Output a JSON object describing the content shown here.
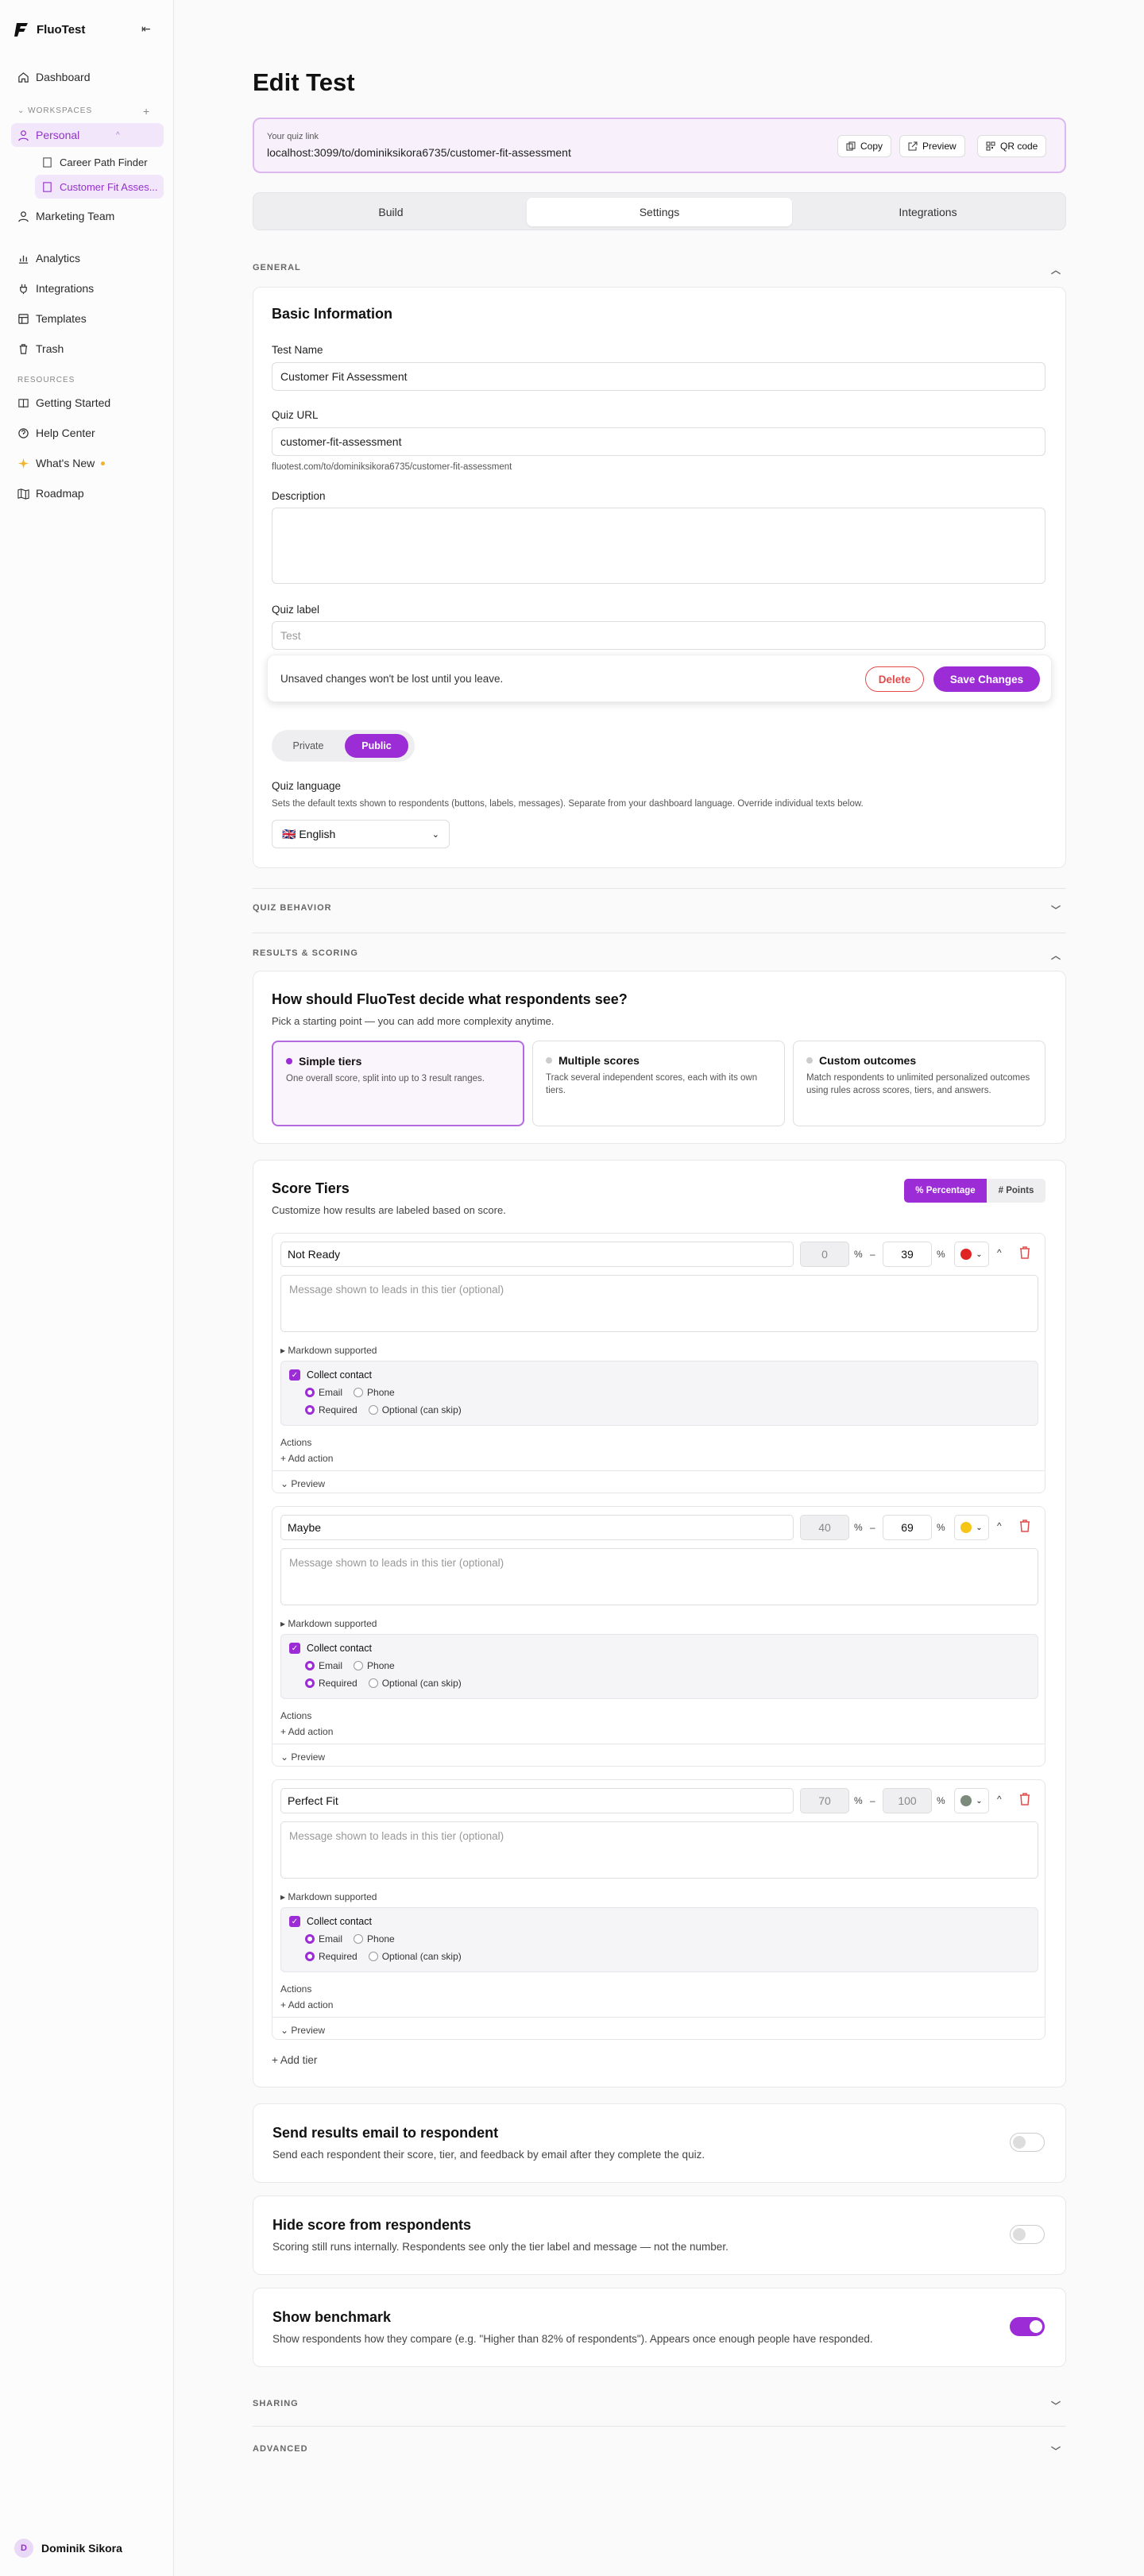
{
  "app": {
    "name": "FluoTest"
  },
  "sidebar": {
    "dashboard": "Dashboard",
    "workspaces_label": "WORKSPACES",
    "personal": "Personal",
    "sub_items": [
      "Career Path Finder",
      "Customer Fit Asses..."
    ],
    "marketing": "Marketing Team",
    "analytics": "Analytics",
    "integrations": "Integrations",
    "templates": "Templates",
    "trash": "Trash",
    "resources_label": "RESOURCES",
    "getting_started": "Getting Started",
    "help_center": "Help Center",
    "whats_new": "What's New",
    "roadmap": "Roadmap",
    "user_initial": "D",
    "user_name": "Dominik Sikora"
  },
  "page": {
    "title": "Edit Test"
  },
  "quiz_link": {
    "label": "Your quiz link",
    "url": "localhost:3099/to/dominiksikora6735/customer-fit-assessment",
    "copy": "Copy",
    "preview": "Preview",
    "qr": "QR code"
  },
  "tabs": [
    "Build",
    "Settings",
    "Integrations"
  ],
  "general": {
    "section": "GENERAL",
    "card_title": "Basic Information",
    "test_name_label": "Test Name",
    "test_name": "Customer Fit Assessment",
    "quiz_url_label": "Quiz URL",
    "quiz_url": "customer-fit-assessment",
    "quiz_url_hint": "fluotest.com/to/dominiksikora6735/customer-fit-assessment",
    "description_label": "Description",
    "quiz_label_label": "Quiz label",
    "quiz_label_placeholder": "Test",
    "visibility_private": "Private",
    "visibility_public": "Public",
    "language_label": "Quiz language",
    "language_hint": "Sets the default texts shown to respondents (buttons, labels, messages). Separate from your dashboard language. Override individual texts below.",
    "language_value": "🇬🇧 English"
  },
  "toast": {
    "message": "Unsaved changes won't be lost until you leave.",
    "delete": "Delete",
    "save": "Save Changes"
  },
  "quiz_behavior": {
    "section": "QUIZ BEHAVIOR"
  },
  "results": {
    "section": "RESULTS & SCORING",
    "question": "How should FluoTest decide what respondents see?",
    "hint": "Pick a starting point — you can add more complexity anytime.",
    "choices": [
      {
        "title": "Simple tiers",
        "desc": "One overall score, split into up to 3 result ranges."
      },
      {
        "title": "Multiple scores",
        "desc": "Track several independent scores, each with its own tiers."
      },
      {
        "title": "Custom outcomes",
        "desc": "Match respondents to unlimited personalized outcomes using rules across scores, tiers, and answers."
      }
    ]
  },
  "score_tiers": {
    "title": "Score Tiers",
    "subtitle": "Customize how results are labeled based on score.",
    "mode_percentage": "% Percentage",
    "mode_points": "# Points",
    "tiers": [
      {
        "name": "Not Ready",
        "min": "0",
        "max": "39",
        "color": "#e02424"
      },
      {
        "name": "Maybe",
        "min": "40",
        "max": "69",
        "color": "#f5c518"
      },
      {
        "name": "Perfect Fit",
        "min": "70",
        "max": "100",
        "color": "#7b8a7b"
      }
    ],
    "pct": "%",
    "dash": "–",
    "message_placeholder": "Message shown to leads in this tier (optional)",
    "markdown": "▸ Markdown supported",
    "collect_contact": "Collect contact",
    "email": "Email",
    "phone": "Phone",
    "required": "Required",
    "optional": "Optional (can skip)",
    "actions": "Actions",
    "add_action": "+ Add action",
    "preview": "⌄ Preview",
    "add_tier": "+ Add tier"
  },
  "toggles": [
    {
      "title": "Send results email to respondent",
      "desc": "Send each respondent their score, tier, and feedback by email after they complete the quiz.",
      "on": false
    },
    {
      "title": "Hide score from respondents",
      "desc": "Scoring still runs internally. Respondents see only the tier label and message — not the number.",
      "on": false
    },
    {
      "title": "Show benchmark",
      "desc": "Show respondents how they compare (e.g. \"Higher than 82% of respondents\"). Appears once enough people have responded.",
      "on": true
    }
  ],
  "sharing": {
    "section": "SHARING"
  },
  "advanced": {
    "section": "ADVANCED"
  },
  "colors": {
    "accent": "#9b2cd6"
  }
}
